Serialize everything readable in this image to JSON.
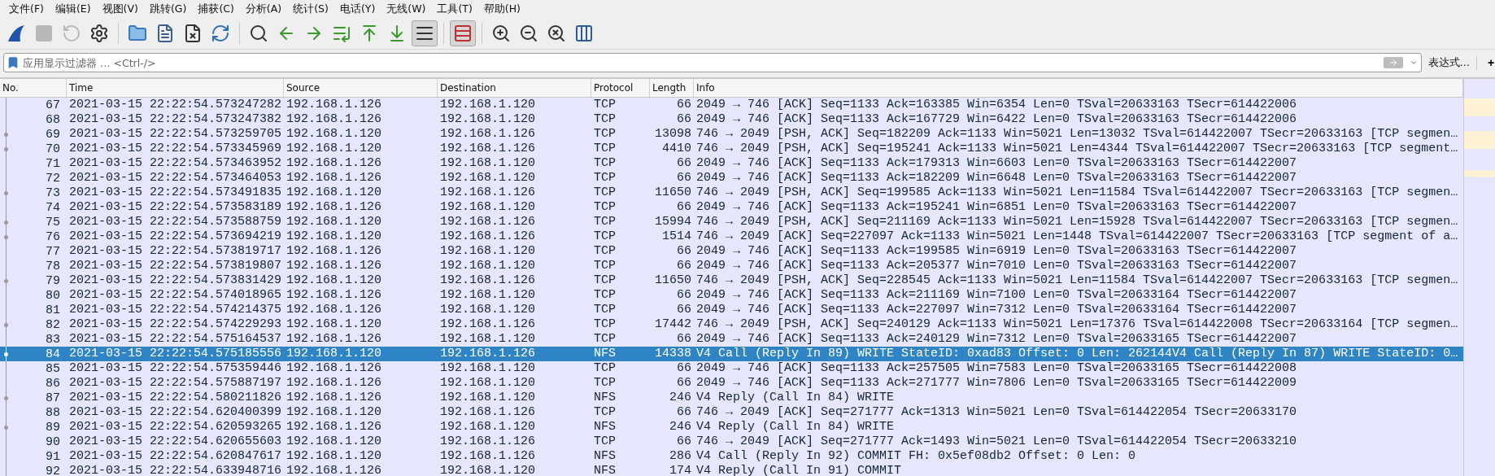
{
  "menu": [
    {
      "label": "文件(F)"
    },
    {
      "label": "编辑(E)"
    },
    {
      "label": "视图(V)"
    },
    {
      "label": "跳转(G)"
    },
    {
      "label": "捕获(C)"
    },
    {
      "label": "分析(A)"
    },
    {
      "label": "统计(S)"
    },
    {
      "label": "电话(Y)"
    },
    {
      "label": "无线(W)"
    },
    {
      "label": "工具(T)"
    },
    {
      "label": "帮助(H)"
    }
  ],
  "toolbar": {
    "groups": [
      [
        {
          "pressed": false,
          "disabled": false
        },
        {
          "pressed": false,
          "disabled": true
        },
        {
          "pressed": false,
          "disabled": true
        },
        {
          "pressed": false,
          "disabled": false
        }
      ],
      [
        {
          "pressed": false,
          "disabled": false
        },
        {
          "pressed": false,
          "disabled": false
        },
        {
          "pressed": false,
          "disabled": false
        },
        {
          "pressed": false,
          "disabled": false
        }
      ],
      [
        {
          "pressed": false,
          "disabled": false
        },
        {
          "pressed": false,
          "disabled": false
        },
        {
          "pressed": false,
          "disabled": false
        },
        {
          "pressed": false,
          "disabled": false
        },
        {
          "pressed": false,
          "disabled": false
        },
        {
          "pressed": false,
          "disabled": false
        },
        {
          "pressed": true,
          "disabled": false
        }
      ],
      [
        {
          "pressed": true,
          "disabled": false
        }
      ],
      [
        {
          "pressed": false,
          "disabled": false
        },
        {
          "pressed": false,
          "disabled": false
        },
        {
          "pressed": false,
          "disabled": false
        },
        {
          "pressed": false,
          "disabled": false
        }
      ]
    ]
  },
  "filter": {
    "placeholder": "应用显示过滤器 … <Ctrl-/>",
    "expression": "表达式…",
    "add": "+"
  },
  "table": {
    "columns": [
      "No.",
      "Time",
      "Source",
      "Destination",
      "Protocol",
      "Length",
      "Info"
    ],
    "rows": [
      {
        "no": "67",
        "time": "2021-03-15 22:22:54.573247282",
        "source": "192.168.1.126",
        "destination": "192.168.1.120",
        "protocol": "TCP",
        "length": "66",
        "info": "2049 → 746 [ACK] Seq=1133 Ack=163385 Win=6354 Len=0 TSval=20633163 TSecr=614422006",
        "selected": false,
        "related": false
      },
      {
        "no": "68",
        "time": "2021-03-15 22:22:54.573247382",
        "source": "192.168.1.126",
        "destination": "192.168.1.120",
        "protocol": "TCP",
        "length": "66",
        "info": "2049 → 746 [ACK] Seq=1133 Ack=167729 Win=6422 Len=0 TSval=20633163 TSecr=614422006",
        "selected": false,
        "related": false
      },
      {
        "no": "69",
        "time": "2021-03-15 22:22:54.573259705",
        "source": "192.168.1.120",
        "destination": "192.168.1.126",
        "protocol": "TCP",
        "length": "13098",
        "info": "746 → 2049 [PSH, ACK] Seq=182209 Ack=1133 Win=5021 Len=13032 TSval=614422007 TSecr=20633163 [TCP segmen…",
        "selected": false,
        "related": true
      },
      {
        "no": "70",
        "time": "2021-03-15 22:22:54.573345969",
        "source": "192.168.1.120",
        "destination": "192.168.1.126",
        "protocol": "TCP",
        "length": "4410",
        "info": "746 → 2049 [PSH, ACK] Seq=195241 Ack=1133 Win=5021 Len=4344 TSval=614422007 TSecr=20633163 [TCP segment…",
        "selected": false,
        "related": true
      },
      {
        "no": "71",
        "time": "2021-03-15 22:22:54.573463952",
        "source": "192.168.1.126",
        "destination": "192.168.1.120",
        "protocol": "TCP",
        "length": "66",
        "info": "2049 → 746 [ACK] Seq=1133 Ack=179313 Win=6603 Len=0 TSval=20633163 TSecr=614422007",
        "selected": false,
        "related": false
      },
      {
        "no": "72",
        "time": "2021-03-15 22:22:54.573464053",
        "source": "192.168.1.126",
        "destination": "192.168.1.120",
        "protocol": "TCP",
        "length": "66",
        "info": "2049 → 746 [ACK] Seq=1133 Ack=182209 Win=6648 Len=0 TSval=20633163 TSecr=614422007",
        "selected": false,
        "related": false
      },
      {
        "no": "73",
        "time": "2021-03-15 22:22:54.573491835",
        "source": "192.168.1.120",
        "destination": "192.168.1.126",
        "protocol": "TCP",
        "length": "11650",
        "info": "746 → 2049 [PSH, ACK] Seq=199585 Ack=1133 Win=5021 Len=11584 TSval=614422007 TSecr=20633163 [TCP segmen…",
        "selected": false,
        "related": true
      },
      {
        "no": "74",
        "time": "2021-03-15 22:22:54.573583189",
        "source": "192.168.1.126",
        "destination": "192.168.1.120",
        "protocol": "TCP",
        "length": "66",
        "info": "2049 → 746 [ACK] Seq=1133 Ack=195241 Win=6851 Len=0 TSval=20633163 TSecr=614422007",
        "selected": false,
        "related": false
      },
      {
        "no": "75",
        "time": "2021-03-15 22:22:54.573588759",
        "source": "192.168.1.120",
        "destination": "192.168.1.126",
        "protocol": "TCP",
        "length": "15994",
        "info": "746 → 2049 [PSH, ACK] Seq=211169 Ack=1133 Win=5021 Len=15928 TSval=614422007 TSecr=20633163 [TCP segmen…",
        "selected": false,
        "related": true
      },
      {
        "no": "76",
        "time": "2021-03-15 22:22:54.573694219",
        "source": "192.168.1.120",
        "destination": "192.168.1.126",
        "protocol": "TCP",
        "length": "1514",
        "info": "746 → 2049 [ACK] Seq=227097 Ack=1133 Win=5021 Len=1448 TSval=614422007 TSecr=20633163 [TCP segment of a…",
        "selected": false,
        "related": true
      },
      {
        "no": "77",
        "time": "2021-03-15 22:22:54.573819717",
        "source": "192.168.1.126",
        "destination": "192.168.1.120",
        "protocol": "TCP",
        "length": "66",
        "info": "2049 → 746 [ACK] Seq=1133 Ack=199585 Win=6919 Len=0 TSval=20633163 TSecr=614422007",
        "selected": false,
        "related": false
      },
      {
        "no": "78",
        "time": "2021-03-15 22:22:54.573819807",
        "source": "192.168.1.126",
        "destination": "192.168.1.120",
        "protocol": "TCP",
        "length": "66",
        "info": "2049 → 746 [ACK] Seq=1133 Ack=205377 Win=7010 Len=0 TSval=20633163 TSecr=614422007",
        "selected": false,
        "related": false
      },
      {
        "no": "79",
        "time": "2021-03-15 22:22:54.573831429",
        "source": "192.168.1.120",
        "destination": "192.168.1.126",
        "protocol": "TCP",
        "length": "11650",
        "info": "746 → 2049 [PSH, ACK] Seq=228545 Ack=1133 Win=5021 Len=11584 TSval=614422007 TSecr=20633163 [TCP segmen…",
        "selected": false,
        "related": true
      },
      {
        "no": "80",
        "time": "2021-03-15 22:22:54.574018965",
        "source": "192.168.1.126",
        "destination": "192.168.1.120",
        "protocol": "TCP",
        "length": "66",
        "info": "2049 → 746 [ACK] Seq=1133 Ack=211169 Win=7100 Len=0 TSval=20633164 TSecr=614422007",
        "selected": false,
        "related": false
      },
      {
        "no": "81",
        "time": "2021-03-15 22:22:54.574214375",
        "source": "192.168.1.126",
        "destination": "192.168.1.120",
        "protocol": "TCP",
        "length": "66",
        "info": "2049 → 746 [ACK] Seq=1133 Ack=227097 Win=7312 Len=0 TSval=20633164 TSecr=614422007",
        "selected": false,
        "related": false
      },
      {
        "no": "82",
        "time": "2021-03-15 22:22:54.574229293",
        "source": "192.168.1.120",
        "destination": "192.168.1.126",
        "protocol": "TCP",
        "length": "17442",
        "info": "746 → 2049 [PSH, ACK] Seq=240129 Ack=1133 Win=5021 Len=17376 TSval=614422008 TSecr=20633164 [TCP segmen…",
        "selected": false,
        "related": true
      },
      {
        "no": "83",
        "time": "2021-03-15 22:22:54.575164537",
        "source": "192.168.1.126",
        "destination": "192.168.1.120",
        "protocol": "TCP",
        "length": "66",
        "info": "2049 → 746 [ACK] Seq=1133 Ack=240129 Win=7312 Len=0 TSval=20633165 TSecr=614422007",
        "selected": false,
        "related": false
      },
      {
        "no": "84",
        "time": "2021-03-15 22:22:54.575185556",
        "source": "192.168.1.120",
        "destination": "192.168.1.126",
        "protocol": "NFS",
        "length": "14338",
        "info": "V4 Call (Reply In 89) WRITE StateID: 0xad83 Offset: 0 Len: 262144V4 Call (Reply In 87) WRITE StateID: 0…",
        "selected": true,
        "related": true
      },
      {
        "no": "85",
        "time": "2021-03-15 22:22:54.575359446",
        "source": "192.168.1.126",
        "destination": "192.168.1.120",
        "protocol": "TCP",
        "length": "66",
        "info": "2049 → 746 [ACK] Seq=1133 Ack=257505 Win=7583 Len=0 TSval=20633165 TSecr=614422008",
        "selected": false,
        "related": false
      },
      {
        "no": "86",
        "time": "2021-03-15 22:22:54.575887197",
        "source": "192.168.1.126",
        "destination": "192.168.1.120",
        "protocol": "TCP",
        "length": "66",
        "info": "2049 → 746 [ACK] Seq=1133 Ack=271777 Win=7806 Len=0 TSval=20633165 TSecr=614422009",
        "selected": false,
        "related": false
      },
      {
        "no": "87",
        "time": "2021-03-15 22:22:54.580211826",
        "source": "192.168.1.126",
        "destination": "192.168.1.120",
        "protocol": "NFS",
        "length": "246",
        "info": "V4 Reply (Call In 84) WRITE",
        "selected": false,
        "related": true
      },
      {
        "no": "88",
        "time": "2021-03-15 22:22:54.620400399",
        "source": "192.168.1.120",
        "destination": "192.168.1.126",
        "protocol": "TCP",
        "length": "66",
        "info": "746 → 2049 [ACK] Seq=271777 Ack=1313 Win=5021 Len=0 TSval=614422054 TSecr=20633170",
        "selected": false,
        "related": false
      },
      {
        "no": "89",
        "time": "2021-03-15 22:22:54.620593265",
        "source": "192.168.1.126",
        "destination": "192.168.1.120",
        "protocol": "NFS",
        "length": "246",
        "info": "V4 Reply (Call In 84) WRITE",
        "selected": false,
        "related": true
      },
      {
        "no": "90",
        "time": "2021-03-15 22:22:54.620655603",
        "source": "192.168.1.120",
        "destination": "192.168.1.126",
        "protocol": "TCP",
        "length": "66",
        "info": "746 → 2049 [ACK] Seq=271777 Ack=1493 Win=5021 Len=0 TSval=614422054 TSecr=20633210",
        "selected": false,
        "related": false
      },
      {
        "no": "91",
        "time": "2021-03-15 22:22:54.620847617",
        "source": "192.168.1.120",
        "destination": "192.168.1.126",
        "protocol": "NFS",
        "length": "286",
        "info": "V4 Call (Reply In 92) COMMIT FH: 0x5ef08db2 Offset: 0 Len: 0",
        "selected": false,
        "related": false
      },
      {
        "no": "92",
        "time": "2021-03-15 22:22:54.633948716",
        "source": "192.168.1.126",
        "destination": "192.168.1.120",
        "protocol": "NFS",
        "length": "174",
        "info": "V4 Reply (Call In 91) COMMIT",
        "selected": false,
        "related": false
      }
    ]
  }
}
